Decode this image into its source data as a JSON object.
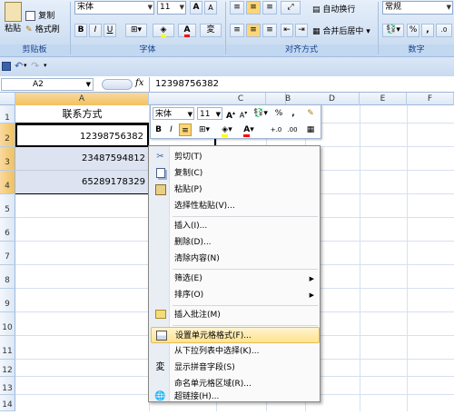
{
  "ribbon": {
    "clipboard": {
      "paste": "粘贴",
      "copy": "复制",
      "format_painter": "格式刷",
      "group": "剪贴板"
    },
    "font": {
      "name": "宋体",
      "size": "11",
      "group": "字体",
      "bold": "B",
      "italic": "I",
      "underline": "U",
      "grow": "A",
      "shrink": "A"
    },
    "alignment": {
      "wrap": "自动换行",
      "merge": "合并后居中",
      "group": "对齐方式"
    },
    "number": {
      "format": "常规",
      "group": "数字",
      "percent": "%",
      "comma": ","
    }
  },
  "formula_bar": {
    "name_box": "A2",
    "fx": "fx",
    "value": "12398756382"
  },
  "columns": [
    "A",
    "B",
    "C",
    "D",
    "E",
    "F"
  ],
  "rows": [
    "1",
    "2",
    "3",
    "4",
    "5",
    "6",
    "7",
    "8",
    "9",
    "10",
    "11",
    "12",
    "13",
    "14"
  ],
  "cells": {
    "a1": "联系方式",
    "a2": "12398756382",
    "a3": "23487594812",
    "a4": "65289178329"
  },
  "mini_toolbar": {
    "font": "宋体",
    "size": "11",
    "percent": "%",
    "comma": ",",
    "bold": "B",
    "italic": "I"
  },
  "context_menu": {
    "items": [
      {
        "label": "剪切(T)",
        "icon": "scissors-icon"
      },
      {
        "label": "复制(C)",
        "icon": "copy-icon"
      },
      {
        "label": "粘贴(P)",
        "icon": "paste-icon"
      },
      {
        "label": "选择性粘贴(V)...",
        "icon": ""
      },
      {
        "label": "插入(I)...",
        "icon": ""
      },
      {
        "label": "删除(D)...",
        "icon": ""
      },
      {
        "label": "清除内容(N)",
        "icon": ""
      },
      {
        "label": "筛选(E)",
        "icon": ""
      },
      {
        "label": "排序(O)",
        "icon": ""
      },
      {
        "label": "插入批注(M)",
        "icon": "comment-icon"
      },
      {
        "label": "设置单元格格式(F)...",
        "icon": "format-cells-icon"
      },
      {
        "label": "从下拉列表中选择(K)...",
        "icon": ""
      },
      {
        "label": "显示拼音字段(S)",
        "icon": "phonetic-icon"
      },
      {
        "label": "命名单元格区域(R)...",
        "icon": ""
      },
      {
        "label": "超链接(H)...",
        "icon": "hyperlink-icon"
      }
    ]
  },
  "colors": {
    "highlight": "#ffe28d",
    "fill_yellow": "#ffff00",
    "font_red": "#ff0000",
    "ribbon_blue": "#d3e2f4"
  }
}
